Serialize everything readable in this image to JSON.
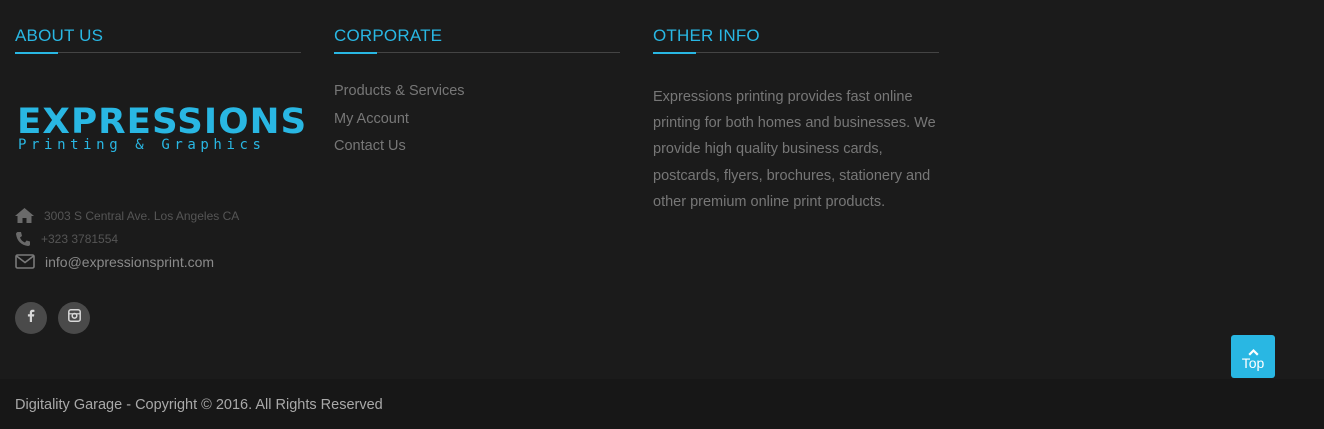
{
  "about": {
    "title": "ABOUT US",
    "logo_main": "EXPRESSIONS",
    "logo_sub": "Printing & Graphics",
    "address": "3003 S Central Ave. Los Angeles CA",
    "phone": "+323 3781554",
    "email": "info@expressionsprint.com",
    "social": [
      "facebook-icon",
      "instagram-icon"
    ]
  },
  "corporate": {
    "title": "CORPORATE",
    "links": [
      "Products & Services",
      "My Account",
      "Contact Us"
    ]
  },
  "other": {
    "title": "OTHER INFO",
    "text": "Expressions printing provides fast online printing for both homes and businesses. We provide high quality business cards, postcards, flyers, brochures, stationery and other premium online print products."
  },
  "top_button": {
    "label": "Top"
  },
  "footer": {
    "copyright": "Digitality Garage - Copyright © 2016. All Rights Reserved"
  },
  "colors": {
    "accent": "#29b7e3",
    "background": "#1b1b1b",
    "bottom_bar": "#171717"
  }
}
